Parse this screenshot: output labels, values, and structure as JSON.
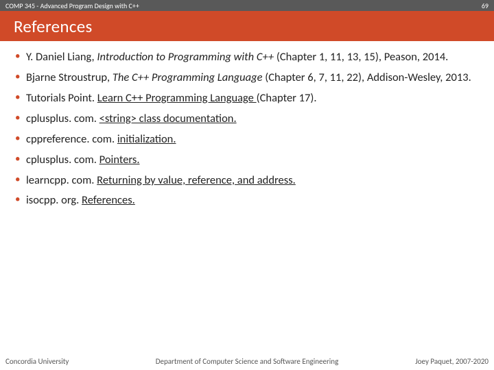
{
  "header": {
    "course": "COMP 345 - Advanced Program Design with C++",
    "slide_number": "69"
  },
  "title": "References",
  "references": [
    {
      "prefix": "Y. Daniel Liang, ",
      "italic": "Introduction to Programming with C++ ",
      "link": "",
      "suffix": "(Chapter 1, 11, 13, 15), Peason, 2014."
    },
    {
      "prefix": "Bjarne Stroustrup, ",
      "italic": "The C++ Programming Language ",
      "link": "",
      "suffix": "(Chapter 6, 7, 11, 22), Addison-Wesley, 2013."
    },
    {
      "prefix": "Tutorials Point. ",
      "italic": "",
      "link": "Learn C++ Programming Language ",
      "suffix": "(Chapter 17)."
    },
    {
      "prefix": "cplusplus. com. ",
      "italic": "",
      "link": "<string> class documentation.",
      "suffix": ""
    },
    {
      "prefix": "cppreference. com. ",
      "italic": "",
      "link": "initialization.",
      "suffix": ""
    },
    {
      "prefix": "cplusplus. com. ",
      "italic": "",
      "link": "Pointers.",
      "suffix": ""
    },
    {
      "prefix": "learncpp. com. ",
      "italic": "",
      "link": "Returning by value, reference, and address.",
      "suffix": ""
    },
    {
      "prefix": "isocpp. org. ",
      "italic": "",
      "link": "References.",
      "suffix": ""
    }
  ],
  "footer": {
    "left": "Concordia University",
    "center": "Department of Computer Science and Software Engineering",
    "right": "Joey Paquet, 2007-2020"
  }
}
